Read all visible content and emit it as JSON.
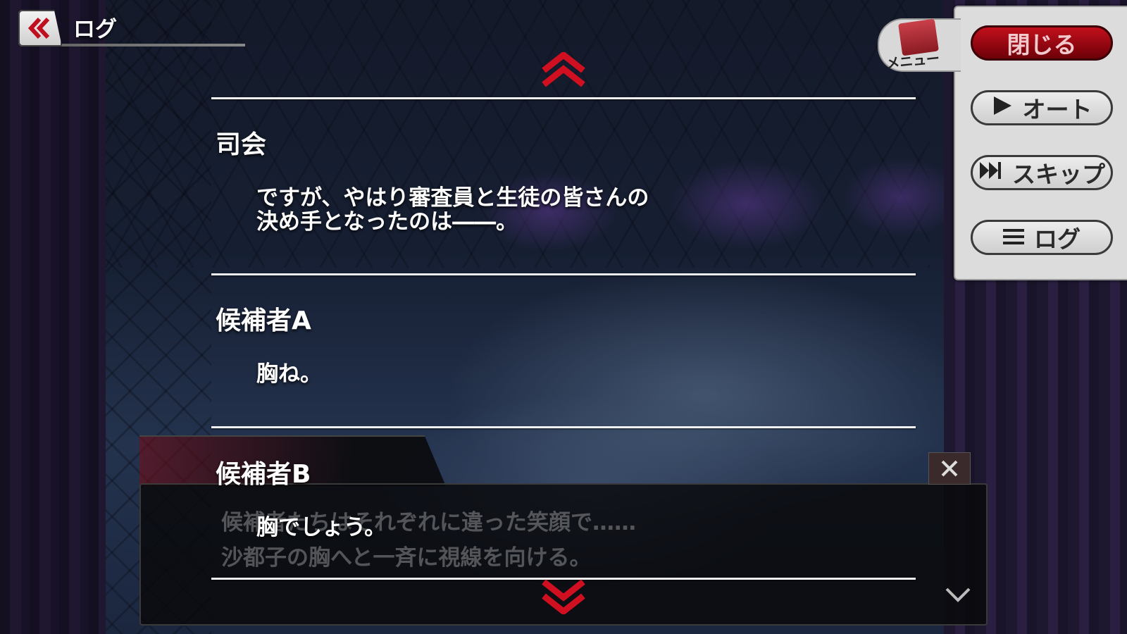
{
  "header": {
    "title": "ログ"
  },
  "log_entries": [
    {
      "speaker": "司会",
      "lines": [
        "ですが、やはり審査員と生徒の皆さんの",
        "決め手となったのは――。"
      ]
    },
    {
      "speaker": "候補者A",
      "lines": [
        "胸ね。"
      ]
    },
    {
      "speaker": "候補者B",
      "lines": [
        "胸でしょう。"
      ]
    }
  ],
  "background_message": {
    "lines": [
      "候補者たちはそれぞれに違った笑顔で……",
      "沙都子の胸へと一斉に視線を向ける。"
    ]
  },
  "side_menu": {
    "tab_label": "メニュー",
    "close_label": "閉じる",
    "auto_label": "オート",
    "skip_label": "スキップ",
    "log_label": "ログ"
  },
  "colors": {
    "accent_red": "#c2101c",
    "arrow_red": "#d01020"
  }
}
